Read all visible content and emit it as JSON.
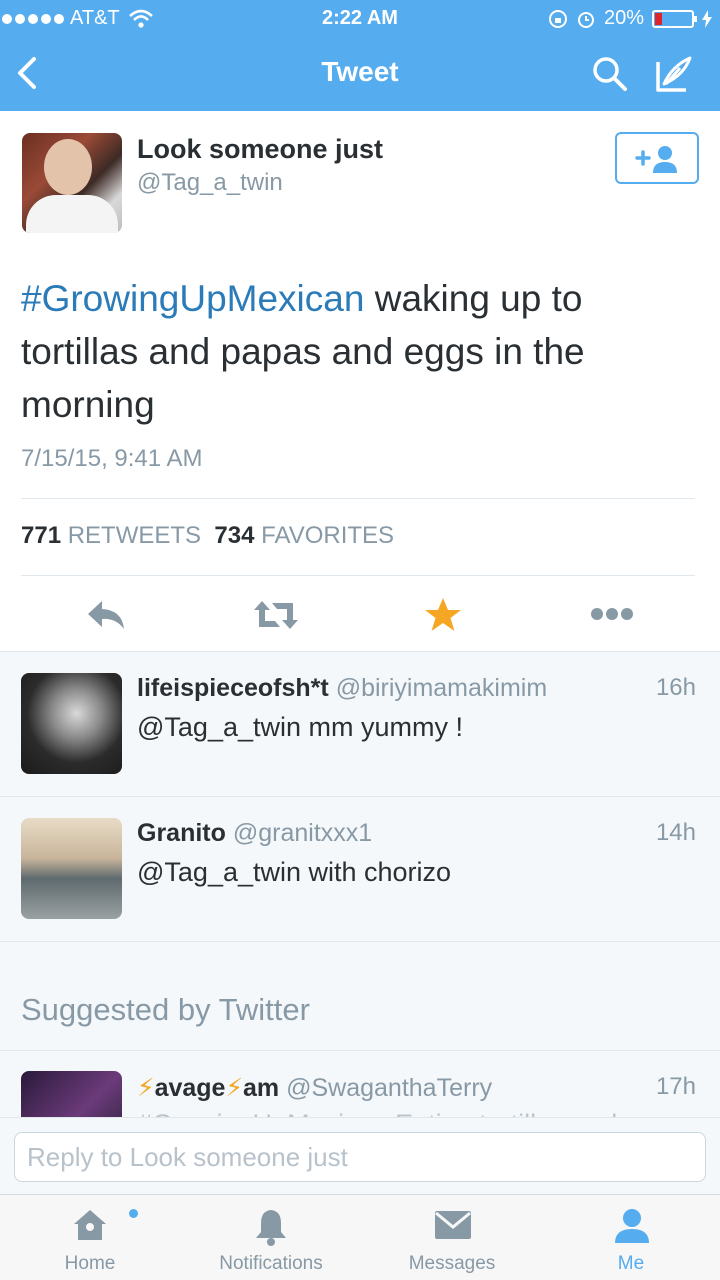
{
  "status_bar": {
    "carrier": "AT&T",
    "time": "2:22 AM",
    "battery": "20%"
  },
  "nav": {
    "title": "Tweet",
    "icons": [
      "back-icon",
      "search-icon",
      "compose-icon"
    ]
  },
  "tweet": {
    "author_name": "Look someone just",
    "author_handle": "@Tag_a_twin",
    "hashtag": "#GrowingUpMexican",
    "text": " waking up to tortillas and papas and eggs in the morning",
    "timestamp": "7/15/15, 9:41 AM",
    "retweets_count": "771",
    "retweets_label": "RETWEETS",
    "favorites_count": "734",
    "favorites_label": "FAVORITES",
    "favorited": true
  },
  "replies": [
    {
      "name": "lifeispieceofsh*t",
      "handle": "@biriyimamakimim",
      "time": "16h",
      "text": "@Tag_a_twin mm yummy !"
    },
    {
      "name": "Granito",
      "handle": "@granitxxx1",
      "time": "14h",
      "text": "@Tag_a_twin with chorizo"
    }
  ],
  "suggested": {
    "heading": "Suggested by Twitter",
    "name_parts": [
      "⚡",
      "avage",
      "⚡",
      "am"
    ],
    "handle": "@SwaganthaTerry",
    "time": "17h",
    "text": "#GrowingUpMexican Eating tortillas and"
  },
  "reply_box": {
    "placeholder": "Reply to Look someone just"
  },
  "tabs": [
    {
      "label": "Home",
      "icon": "home-icon"
    },
    {
      "label": "Notifications",
      "icon": "bell-icon"
    },
    {
      "label": "Messages",
      "icon": "envelope-icon"
    },
    {
      "label": "Me",
      "icon": "person-icon",
      "active": true
    }
  ],
  "colors": {
    "brand": "#55acee",
    "link": "#2b7bb9",
    "favorite": "#f5a623",
    "muted": "#8899a6"
  }
}
